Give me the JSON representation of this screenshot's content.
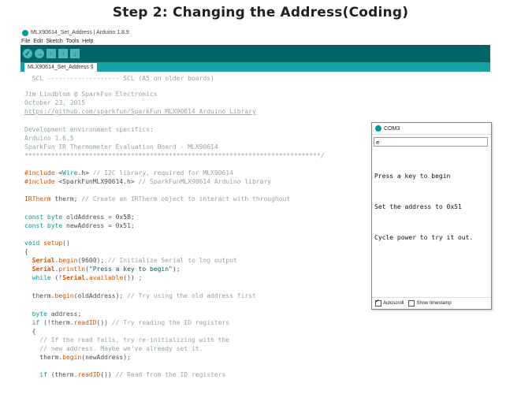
{
  "page_title": "Step 2: Changing the Address(Coding)",
  "window": {
    "title": "MLX90614_Set_Address | Arduino 1.8.9",
    "menu": [
      "File",
      "Edit",
      "Sketch",
      "Tools",
      "Help"
    ],
    "toolbar": [
      "verify-icon",
      "upload-icon",
      "new-icon",
      "open-icon",
      "save-icon"
    ],
    "tab_label": "MLX90614_Set_Address §"
  },
  "code": {
    "l1": "  SCL ------------------- SCL (A5 on older boards)",
    "l2": "Jim Lindblom @ SparkFun Electronics",
    "l3": "October 23, 2015",
    "l4": "https://github.com/sparkfun/SparkFun_MLX90614_Arduino_Library",
    "l5": "Development environment specifics:",
    "l6": "Arduino 1.6.5",
    "l7": "SparkFun IR Thermometer Evaluation Board - MLX90614",
    "l8": "******************************************************************************/",
    "l9_a": "#include",
    "l9_b": " <",
    "l9_c": "Wire",
    "l9_d": ".h> ",
    "l9_e": "// I2C library, required for MLX90614",
    "l10_a": "#include",
    "l10_b": " <SparkFunMLX90614.h> ",
    "l10_c": "// SparkFunMLX90614 Arduino library",
    "l11_a": "IRTherm",
    "l11_b": " therm; ",
    "l11_c": "// Create an IRTherm object to interact with throughout",
    "l12_a": "const",
    "l12_b": " byte",
    "l12_c": " oldAddress = 0x5B;",
    "l13_a": "const",
    "l13_b": " byte",
    "l13_c": " newAddress = 0x51;",
    "l14_a": "void",
    "l14_b": " setup",
    "l14_c": "()",
    "l15": "{",
    "l16_a": "  Serial",
    "l16_b": ".",
    "l16_c": "begin",
    "l16_d": "(9600); ",
    "l16_e": "// Initialize Serial to log output",
    "l17_a": "  Serial",
    "l17_b": ".",
    "l17_c": "println",
    "l17_d": "(",
    "l17_e": "\"Press a key to begin\"",
    "l17_f": ");",
    "l18_a": "  while",
    "l18_b": " (!",
    "l18_c": "Serial",
    "l18_d": ".",
    "l18_e": "available",
    "l18_f": "()) ;",
    "l19_a": "  therm.",
    "l19_b": "begin",
    "l19_c": "(oldAddress); ",
    "l19_d": "// Try using the old address first",
    "l20_a": "  byte",
    "l20_b": " address;",
    "l21_a": "  if",
    "l21_b": " (!therm.",
    "l21_c": "readID",
    "l21_d": "()) ",
    "l21_e": "// Try reading the ID registers",
    "l22": "  {",
    "l23": "    // If the read fails, try re-initializing with the",
    "l24": "    // new address. Maybe we've already set it.",
    "l25_a": "    therm.",
    "l25_b": "begin",
    "l25_c": "(newAddress);",
    "l26_a": "    if",
    "l26_b": " (therm.",
    "l26_c": "readID",
    "l26_d": "()) ",
    "l26_e": "// Read from the ID registers"
  },
  "serial_monitor": {
    "title": "COM3",
    "input_value": "e",
    "output": [
      "Press a key to begin",
      "Set the address to 0x51",
      "Cycle power to try it out."
    ],
    "autoscroll_label": "Autoscroll",
    "timestamp_label": "Show timestamp",
    "autoscroll_checked": true,
    "timestamp_checked": false
  },
  "colors": {
    "toolbar": "#006468",
    "tabbar": "#17a1a5",
    "keyword": "#00979c",
    "function": "#d35400",
    "comment": "#95a5a6"
  }
}
